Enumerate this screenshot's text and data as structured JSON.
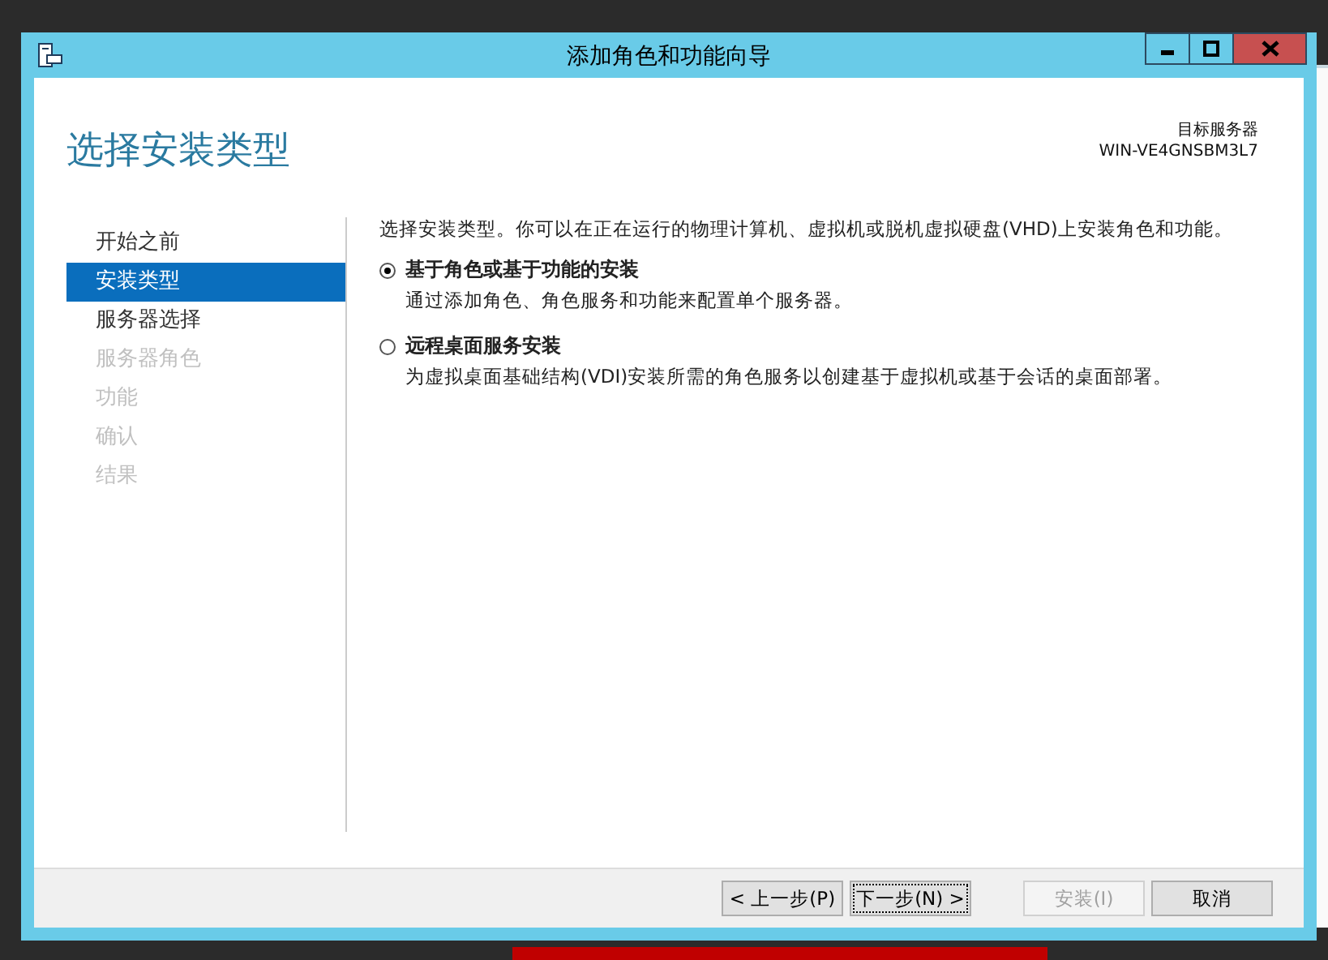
{
  "window": {
    "title": "添加角色和功能向导"
  },
  "page_title": "选择安装类型",
  "target_server": {
    "label": "目标服务器",
    "name": "WIN-VE4GNSBM3L7"
  },
  "steps": [
    {
      "label": "开始之前",
      "selected": false,
      "disabled": false
    },
    {
      "label": "安装类型",
      "selected": true,
      "disabled": false
    },
    {
      "label": "服务器选择",
      "selected": false,
      "disabled": false
    },
    {
      "label": "服务器角色",
      "selected": false,
      "disabled": true
    },
    {
      "label": "功能",
      "selected": false,
      "disabled": true
    },
    {
      "label": "确认",
      "selected": false,
      "disabled": true
    },
    {
      "label": "结果",
      "selected": false,
      "disabled": true
    }
  ],
  "intro": "选择安装类型。你可以在正在运行的物理计算机、虚拟机或脱机虚拟硬盘(VHD)上安装角色和功能。",
  "options": [
    {
      "label": "基于角色或基于功能的安装",
      "description": "通过添加角色、角色服务和功能来配置单个服务器。",
      "selected": true
    },
    {
      "label": "远程桌面服务安装",
      "description": "为虚拟桌面基础结构(VDI)安装所需的角色服务以创建基于虚拟机或基于会话的桌面部署。",
      "selected": false
    }
  ],
  "buttons": [
    {
      "label": "< 上一步(P)",
      "disabled": false,
      "focused": false
    },
    {
      "label": "下一步(N) >",
      "disabled": false,
      "focused": true
    },
    {
      "label": "安装(I)",
      "disabled": true,
      "focused": false
    },
    {
      "label": "取消",
      "disabled": false,
      "focused": false
    }
  ]
}
